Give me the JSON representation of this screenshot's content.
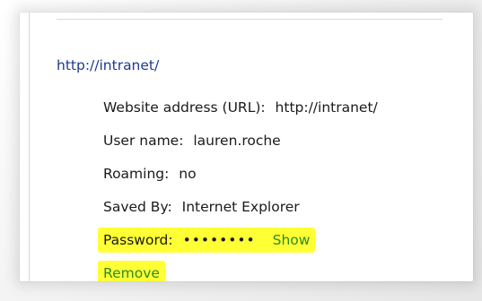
{
  "site": {
    "url_link": "http://intranet/"
  },
  "details": {
    "website_label": "Website address (URL):",
    "website_value": "http://intranet/",
    "username_label": "User name:",
    "username_value": "lauren.roche",
    "roaming_label": "Roaming:",
    "roaming_value": "no",
    "savedby_label": "Saved By:",
    "savedby_value": "Internet Explorer",
    "password_label": "Password:",
    "password_value": "••••••••",
    "show_label": "Show",
    "remove_label": "Remove"
  },
  "colors": {
    "link_blue": "#1f3a8a",
    "action_green": "#2e8b22",
    "highlight_yellow": "#ffff35"
  }
}
